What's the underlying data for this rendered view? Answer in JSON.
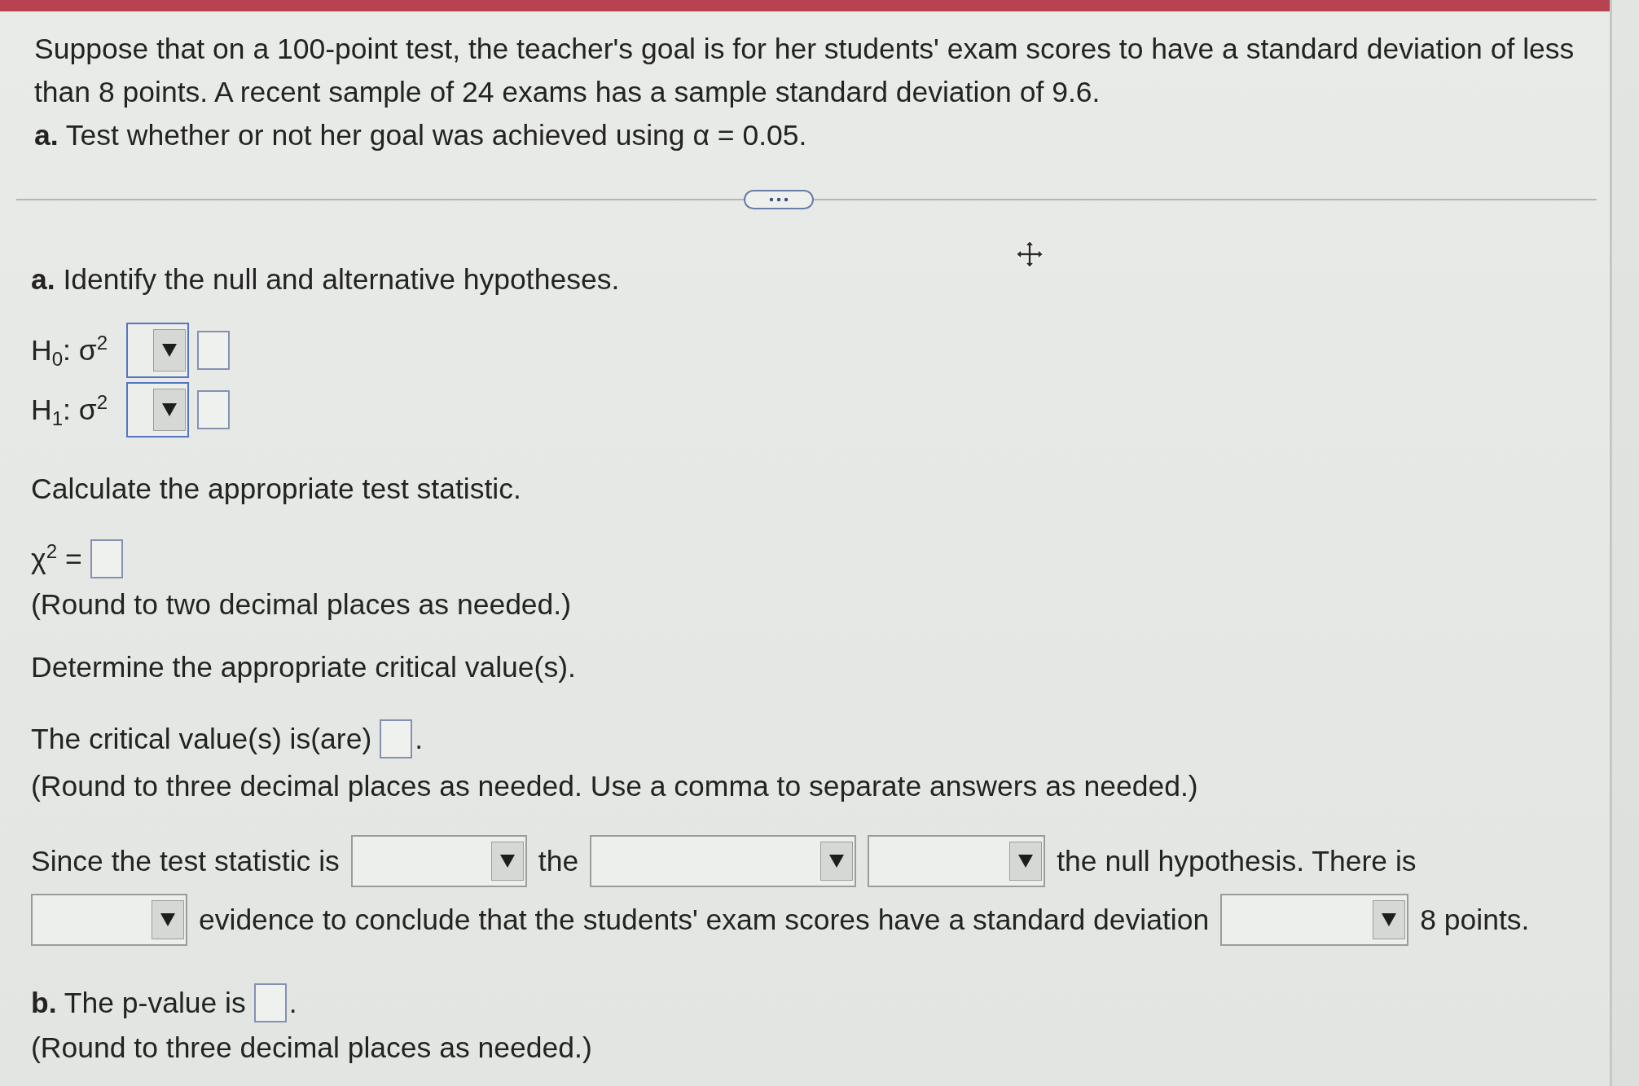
{
  "problem": {
    "statement": "Suppose that on a 100-point test, the teacher's goal is for her students' exam scores to have a standard deviation of less than 8 points. A recent sample of 24 exams has a sample standard deviation of 9.6.",
    "task": "**a.** Test whether or not her goal was achieved using α = 0.05."
  },
  "hypotheses": {
    "heading": "**a.** Identify the null and alternative hypotheses.",
    "rows": [
      {
        "label": "H$_{0}$: σ$^{2}$"
      },
      {
        "label": "H$_{1}$: σ$^{2}$"
      }
    ]
  },
  "test_statistic": {
    "heading": "Calculate the appropriate test statistic.",
    "label": "χ$^{2}$ =",
    "note": "(Round to two decimal places as needed.)"
  },
  "critical_value": {
    "heading": "Determine the appropriate critical value(s).",
    "label": "The critical value(s) is(are)",
    "suffix": ".",
    "note": "(Round to three decimal places as needed. Use a comma to separate answers as needed.)"
  },
  "conclusion": {
    "segments": [
      {
        "kind": "text",
        "text": "Since the test statistic is"
      },
      {
        "kind": "dropdown"
      },
      {
        "kind": "text",
        "text": "the"
      },
      {
        "kind": "dropdown"
      },
      {
        "kind": "dropdown"
      },
      {
        "kind": "text",
        "text": "the null hypothesis. There is"
      },
      {
        "kind": "dropdown"
      },
      {
        "kind": "text",
        "text": "evidence to conclude that the students' exam scores have a standard deviation"
      },
      {
        "kind": "dropdown"
      },
      {
        "kind": "text",
        "text": "8 points."
      }
    ]
  },
  "p_value": {
    "label": "**b.** The p-value is",
    "suffix": ".",
    "note": "(Round to three decimal places as needed.)"
  }
}
